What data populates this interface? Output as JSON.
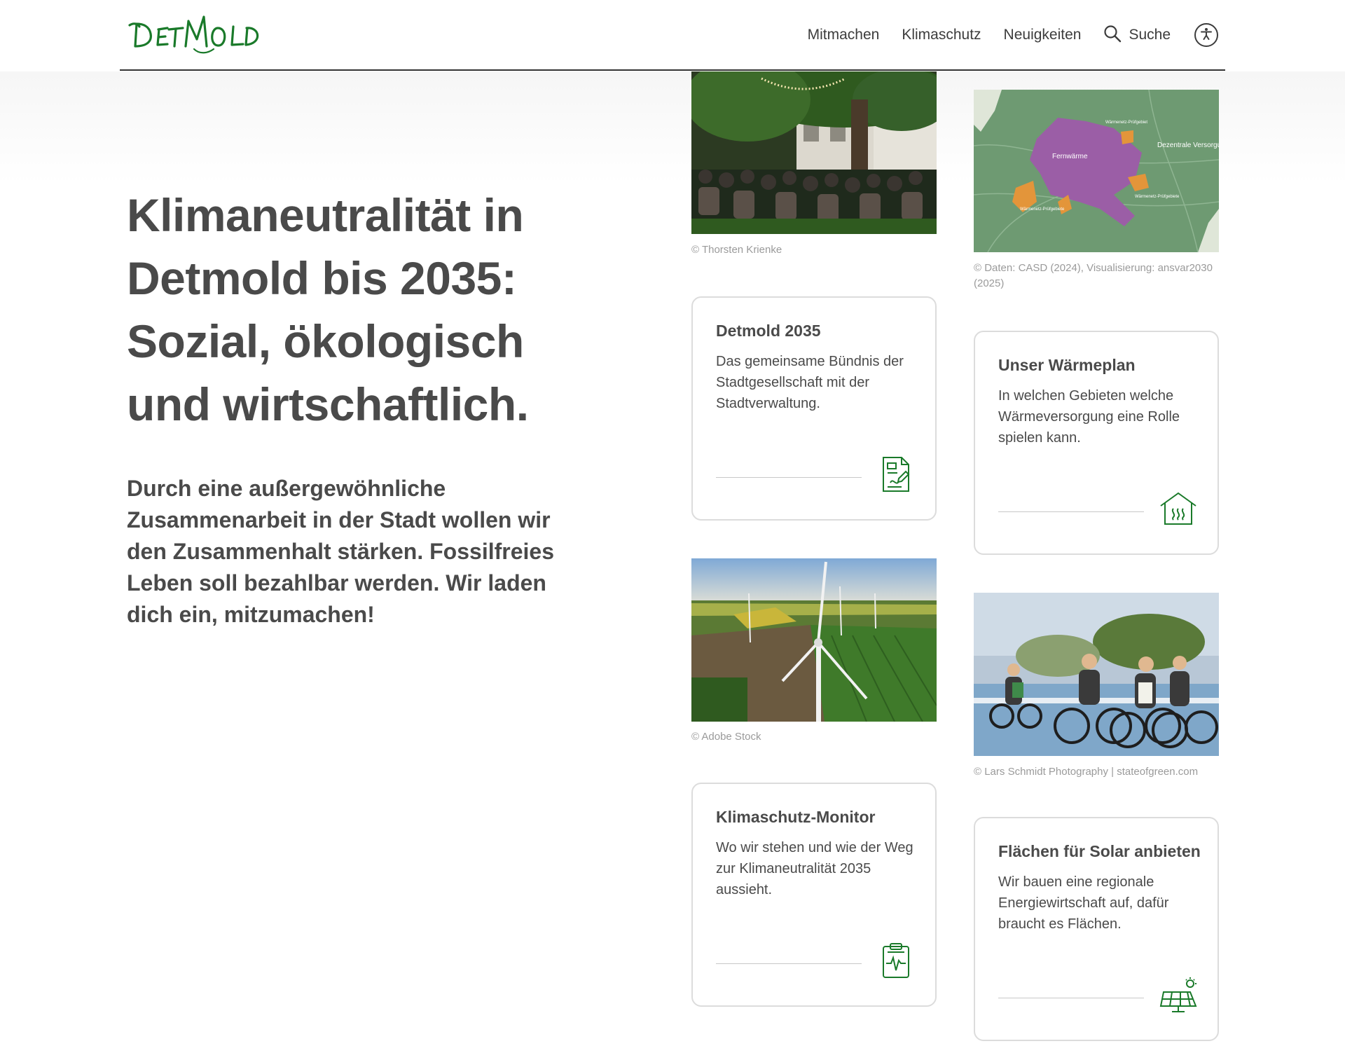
{
  "header": {
    "logo_text": "DETMOLD",
    "nav": [
      "Mitmachen",
      "Klimaschutz",
      "Neuigkeiten"
    ],
    "search_label": "Suche"
  },
  "hero": {
    "title": "Klimaneutralität in Detmold bis 2035: Sozial, ökologisch und wirtschaftlich.",
    "text": "Durch eine außergewöhnliche Zusammenarbeit in der Stadt wollen wir den Zusammenhalt stärken. Fossilfreies Leben soll bezahlbar werden. Wir laden dich ein, mitzumachen!"
  },
  "media": {
    "festival_credit": "© Thorsten Krienke",
    "map_credit": "© Daten: CASD (2024), Visualisierung: ansvar2030 (2025)",
    "map_labels": [
      "Wärmenetz-Prüfgebiet",
      "Fernwärme",
      "Dezentrale Versorgung",
      "Wärmenetz-Prüfgebiete",
      "Wärmenetz-Prüfgebiete"
    ],
    "wind_credit": "© Adobe Stock",
    "bike_credit": "© Lars Schmidt Photography | stateofgreen.com"
  },
  "cards": [
    {
      "title": "Detmold 2035",
      "text": "Das gemeinsame Bündnis der Stadtgesellschaft mit der Stadtverwaltung.",
      "icon": "document-pen-icon"
    },
    {
      "title": "Unser Wärmeplan",
      "text": "In welchen Gebieten welche Wärmeversorgung eine Rolle spielen kann.",
      "icon": "house-heat-icon"
    },
    {
      "title": "Klimaschutz-Monitor",
      "text": "Wo wir stehen und wie der Weg zur Klimaneutralität 2035 aussieht.",
      "icon": "clipboard-pulse-icon"
    },
    {
      "title": "Flächen für Solar anbieten",
      "text": "Wir bauen eine regionale Energiewirtschaft auf, dafür braucht es Flächen.",
      "icon": "solar-panel-icon"
    }
  ],
  "colors": {
    "brand_green": "#1a7a2a",
    "text": "#4a4a4a",
    "credit": "#9a9a9a",
    "card_border": "#dcdcdc"
  }
}
